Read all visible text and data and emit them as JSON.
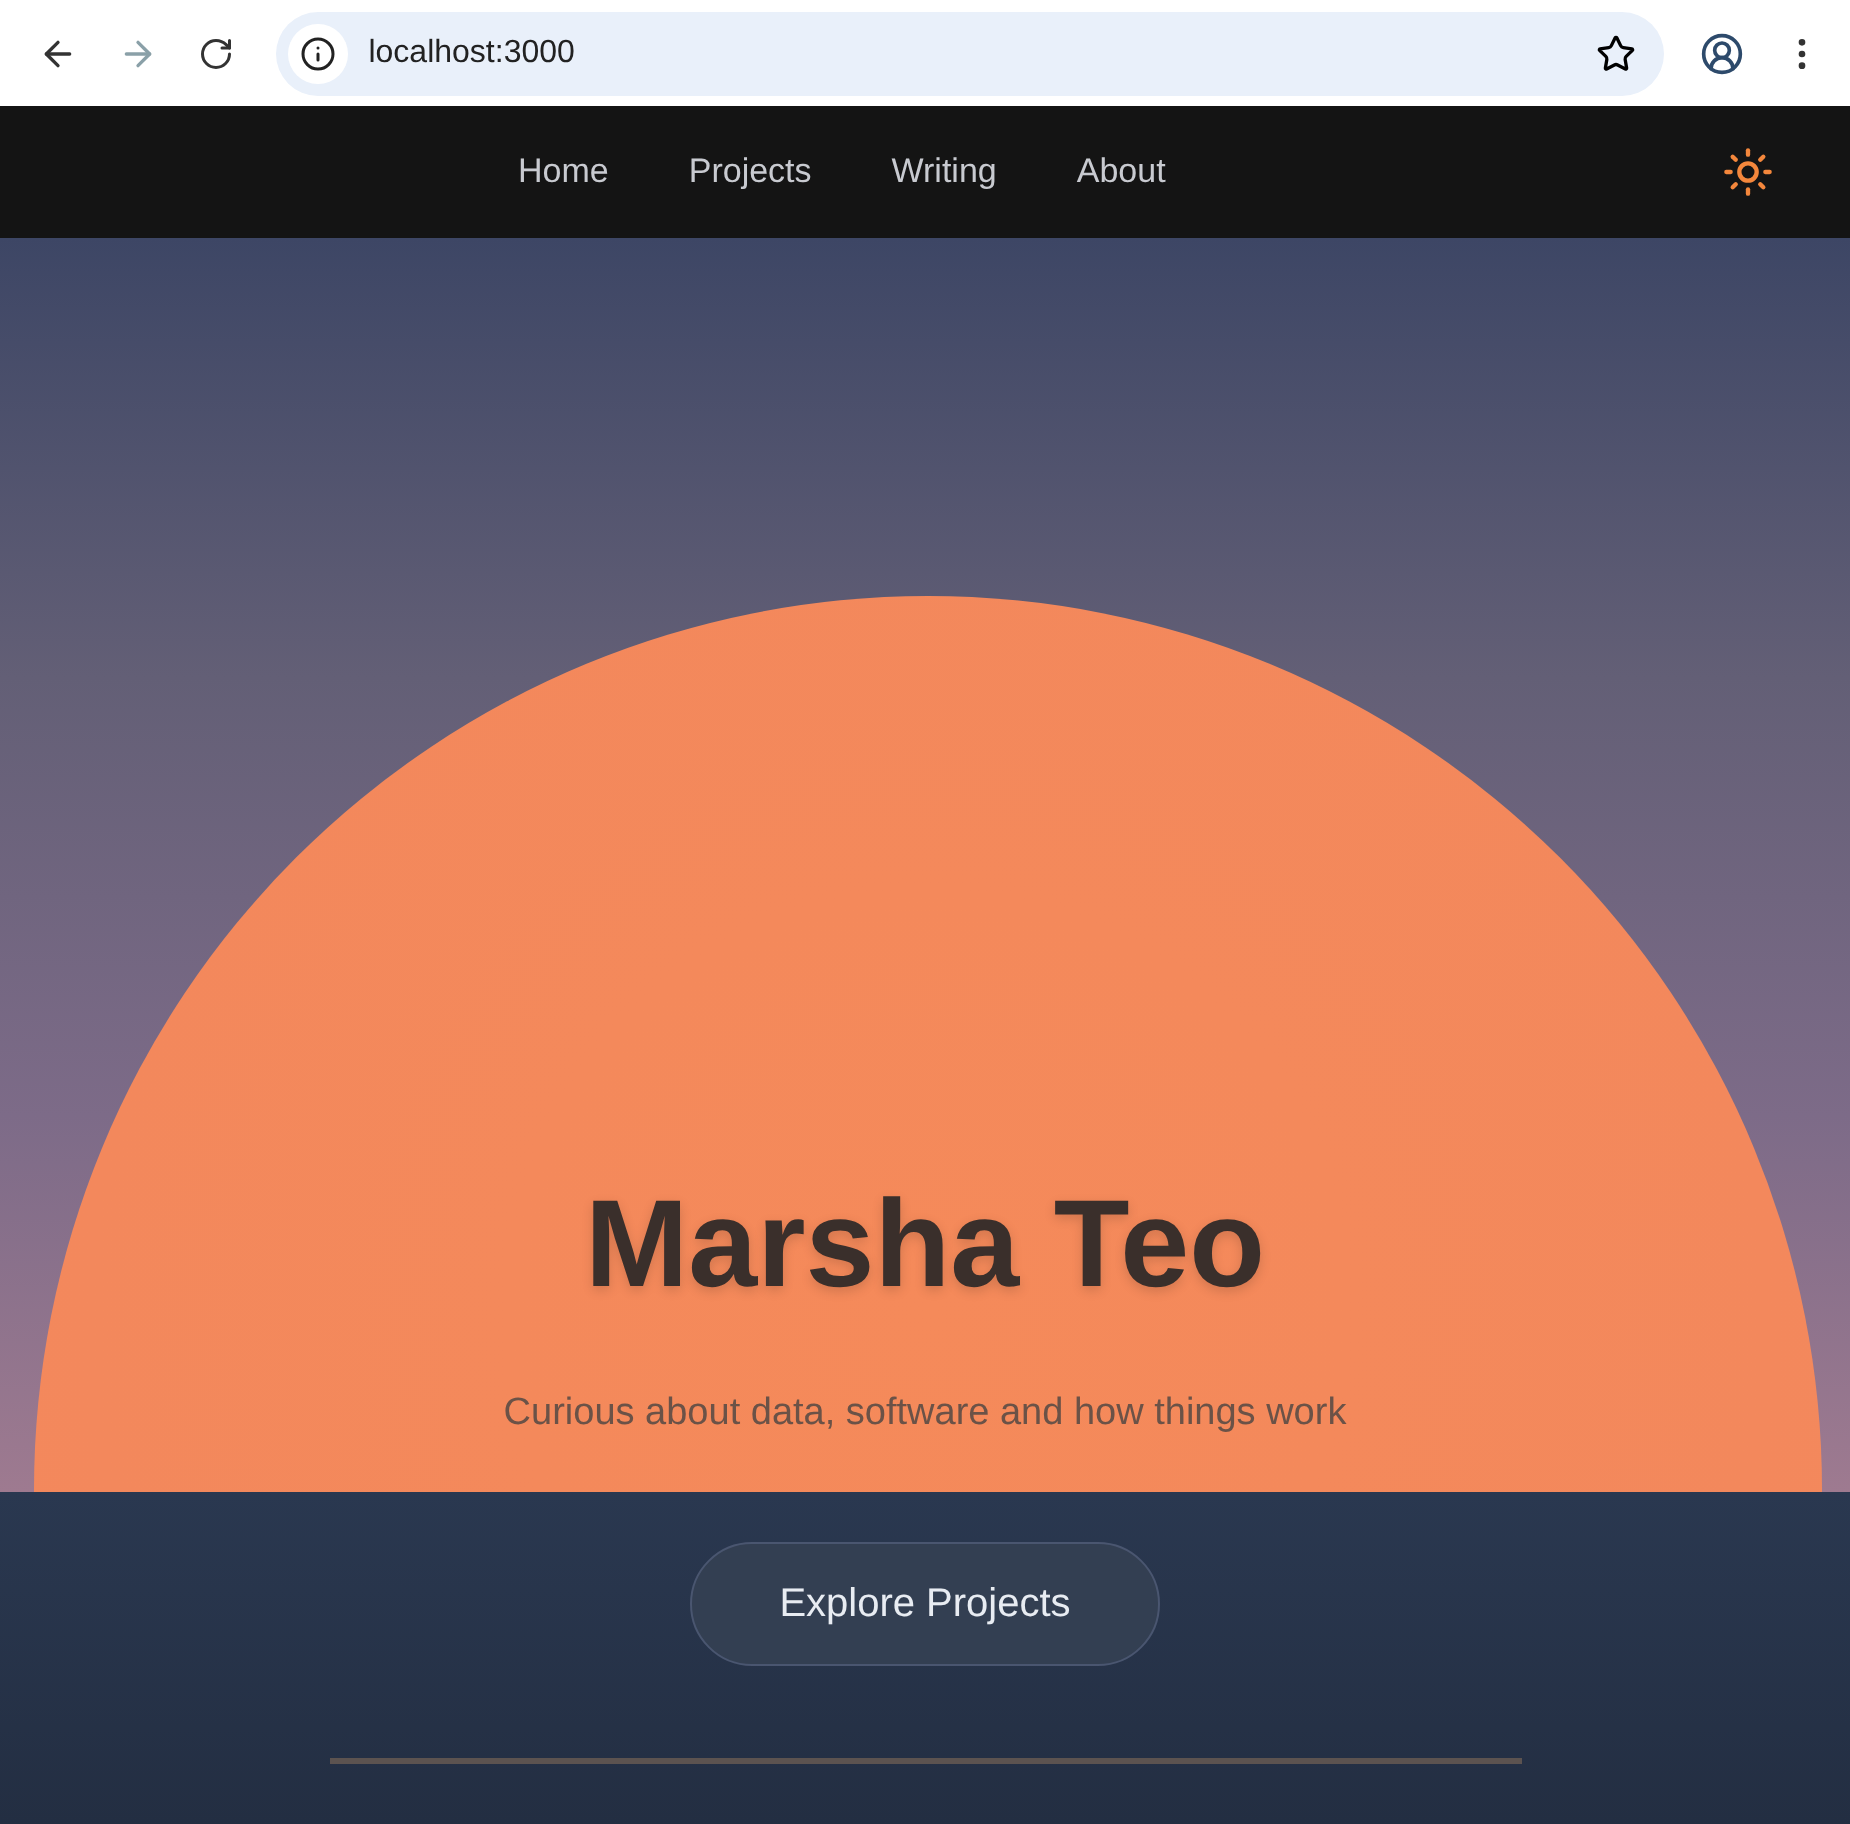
{
  "browser": {
    "url": "localhost:3000"
  },
  "nav": {
    "links": [
      "Home",
      "Projects",
      "Writing",
      "About"
    ]
  },
  "hero": {
    "title": "Marsha Teo",
    "subtitle": "Curious about data, software and how things work",
    "button": "Explore Projects"
  }
}
